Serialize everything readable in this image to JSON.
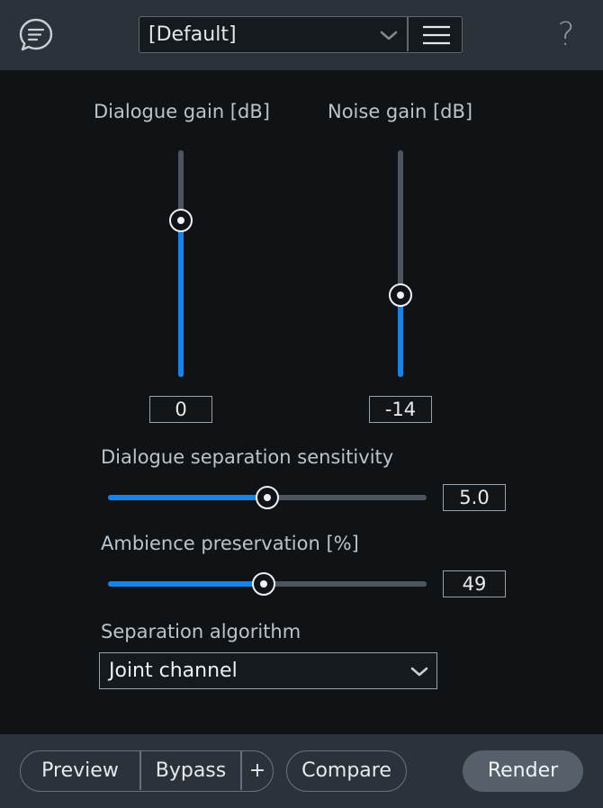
{
  "header": {
    "preset": {
      "selected": "[Default]"
    },
    "icons": {
      "feedback": "chat-bubble-icon",
      "menu": "hamburger-menu-icon",
      "help": "question-mark-icon"
    },
    "help_glyph": "?"
  },
  "dialogue_gain": {
    "label": "Dialogue gain [dB]",
    "value": "0",
    "level_fraction": 0.69
  },
  "noise_gain": {
    "label": "Noise gain [dB]",
    "value": "-14",
    "level_fraction": 0.36
  },
  "sensitivity": {
    "label": "Dialogue separation sensitivity",
    "value": "5.0",
    "level_fraction": 0.5
  },
  "ambience": {
    "label": "Ambience preservation [%]",
    "value": "49",
    "level_fraction": 0.49
  },
  "algorithm": {
    "label": "Separation algorithm",
    "selected": "Joint channel"
  },
  "footer": {
    "preview_label": "Preview",
    "bypass_label": "Bypass",
    "add_label": "+",
    "compare_label": "Compare",
    "render_label": "Render"
  },
  "colors": {
    "accent": "#1683ec",
    "panel": "#2b323a",
    "background": "#0f1316"
  }
}
